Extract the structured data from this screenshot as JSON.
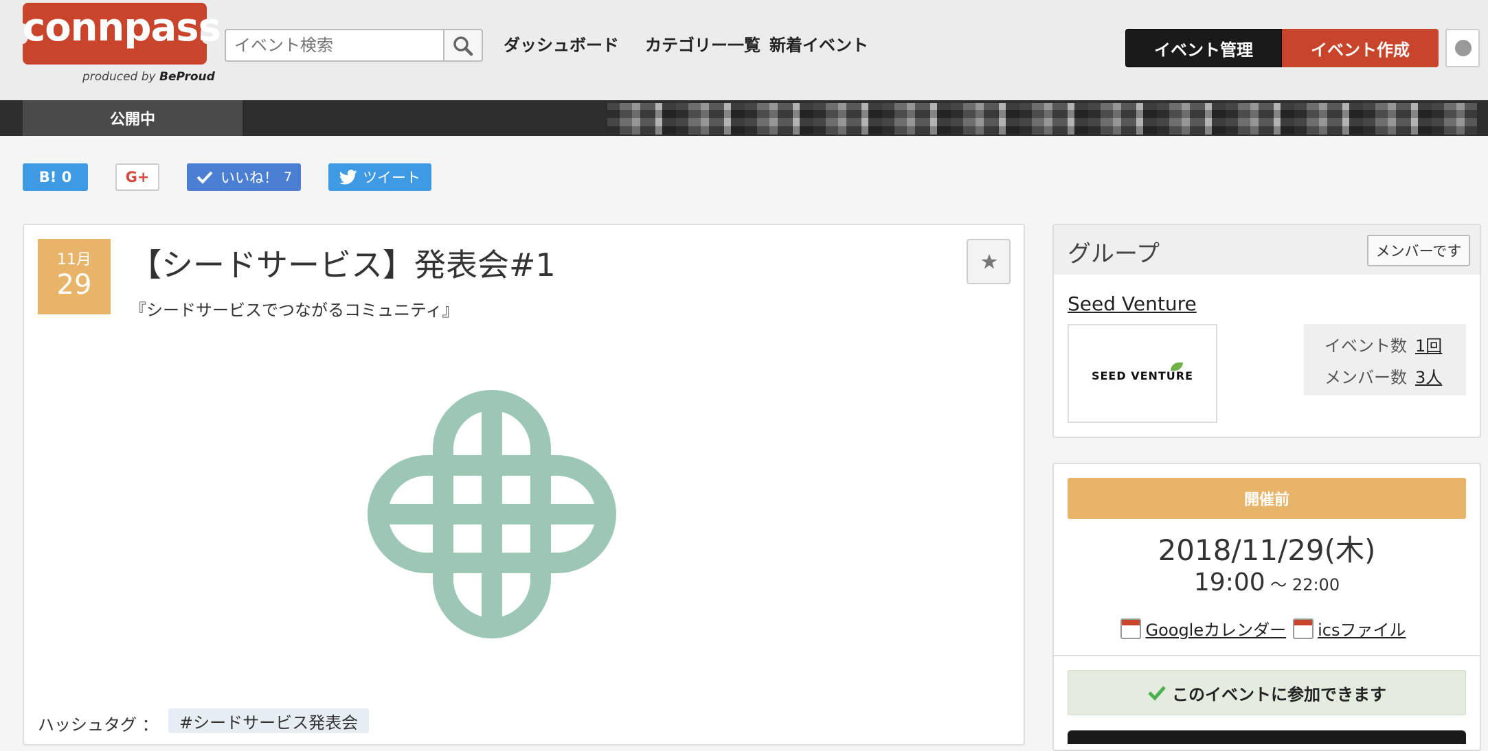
{
  "header": {
    "logo_text": "connpass",
    "produced_by": "produced by",
    "produced_brand": "BeProud",
    "search_placeholder": "イベント検索",
    "nav": [
      "ダッシュボード",
      "カテゴリー一覧",
      "新着イベント"
    ],
    "manage_label": "イベント管理",
    "create_label": "イベント作成"
  },
  "tabbar": {
    "public_label": "公開中"
  },
  "social": {
    "hatena_label": "B! 0",
    "gplus_label": "G+",
    "like_label": "いいね！",
    "like_count": "7",
    "tweet_label": "ツイート"
  },
  "event": {
    "month": "11月",
    "day": "29",
    "title": "【シードサービス】発表会#1",
    "subtitle": "『シードサービスでつながるコミュニティ』",
    "hashtag_label": "ハッシュタグ ：",
    "hashtag": "#シードサービス発表会",
    "image_color": "#9cc7b4"
  },
  "group": {
    "title": "グループ",
    "member_label": "メンバーです",
    "name": "Seed Venture",
    "logo_text": "SEED VENTURE",
    "event_count_label": "イベント数",
    "event_count": "1回",
    "member_count_label": "メンバー数",
    "member_count": "3人"
  },
  "schedule": {
    "status": "開催前",
    "date": "2018/11/29(木)",
    "start": "19:00",
    "sep": " ～ ",
    "end": "22:00",
    "google_cal": "Googleカレンダー",
    "ics": "icsファイル",
    "join_text": "このイベントに参加できます"
  },
  "colors": {
    "brand_red": "#c8442a",
    "date_orange": "#e8b46a",
    "join_green": "#e3ecdf"
  }
}
